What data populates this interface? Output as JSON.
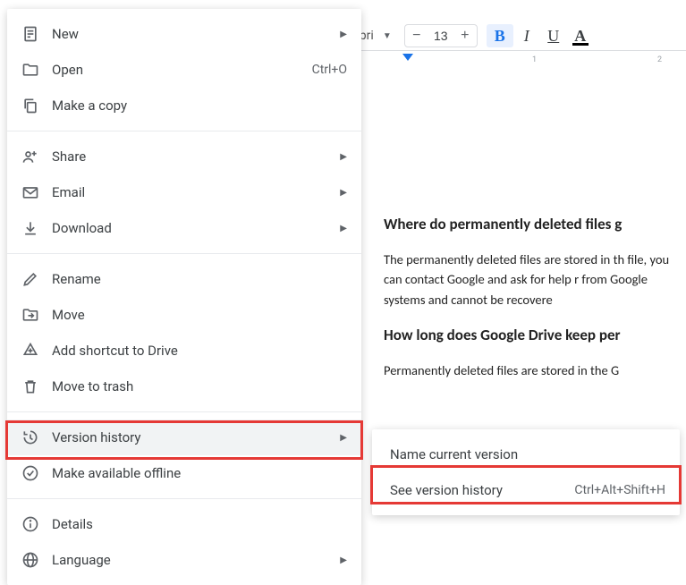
{
  "toolbar": {
    "font_name": "libri",
    "font_size": "13"
  },
  "ruler": {
    "m1": "1",
    "m2": "2"
  },
  "doc": {
    "heading1": "Where do permanently deleted files g",
    "para1": "The permanently deleted files are stored in th file, you can contact Google and ask for help r from Google systems and cannot be recovere",
    "heading2": "How long does Google Drive keep per",
    "para2": "Permanently deleted files are stored in the G"
  },
  "menu": {
    "new": "New",
    "open": "Open",
    "open_shortcut": "Ctrl+O",
    "make_copy": "Make a copy",
    "share": "Share",
    "email": "Email",
    "download": "Download",
    "rename": "Rename",
    "move": "Move",
    "add_shortcut": "Add shortcut to Drive",
    "move_to_trash": "Move to trash",
    "version_history": "Version history",
    "make_offline": "Make available offline",
    "details": "Details",
    "language": "Language"
  },
  "submenu": {
    "name_current": "Name current version",
    "see_history": "See version history",
    "see_history_shortcut": "Ctrl+Alt+Shift+H"
  }
}
